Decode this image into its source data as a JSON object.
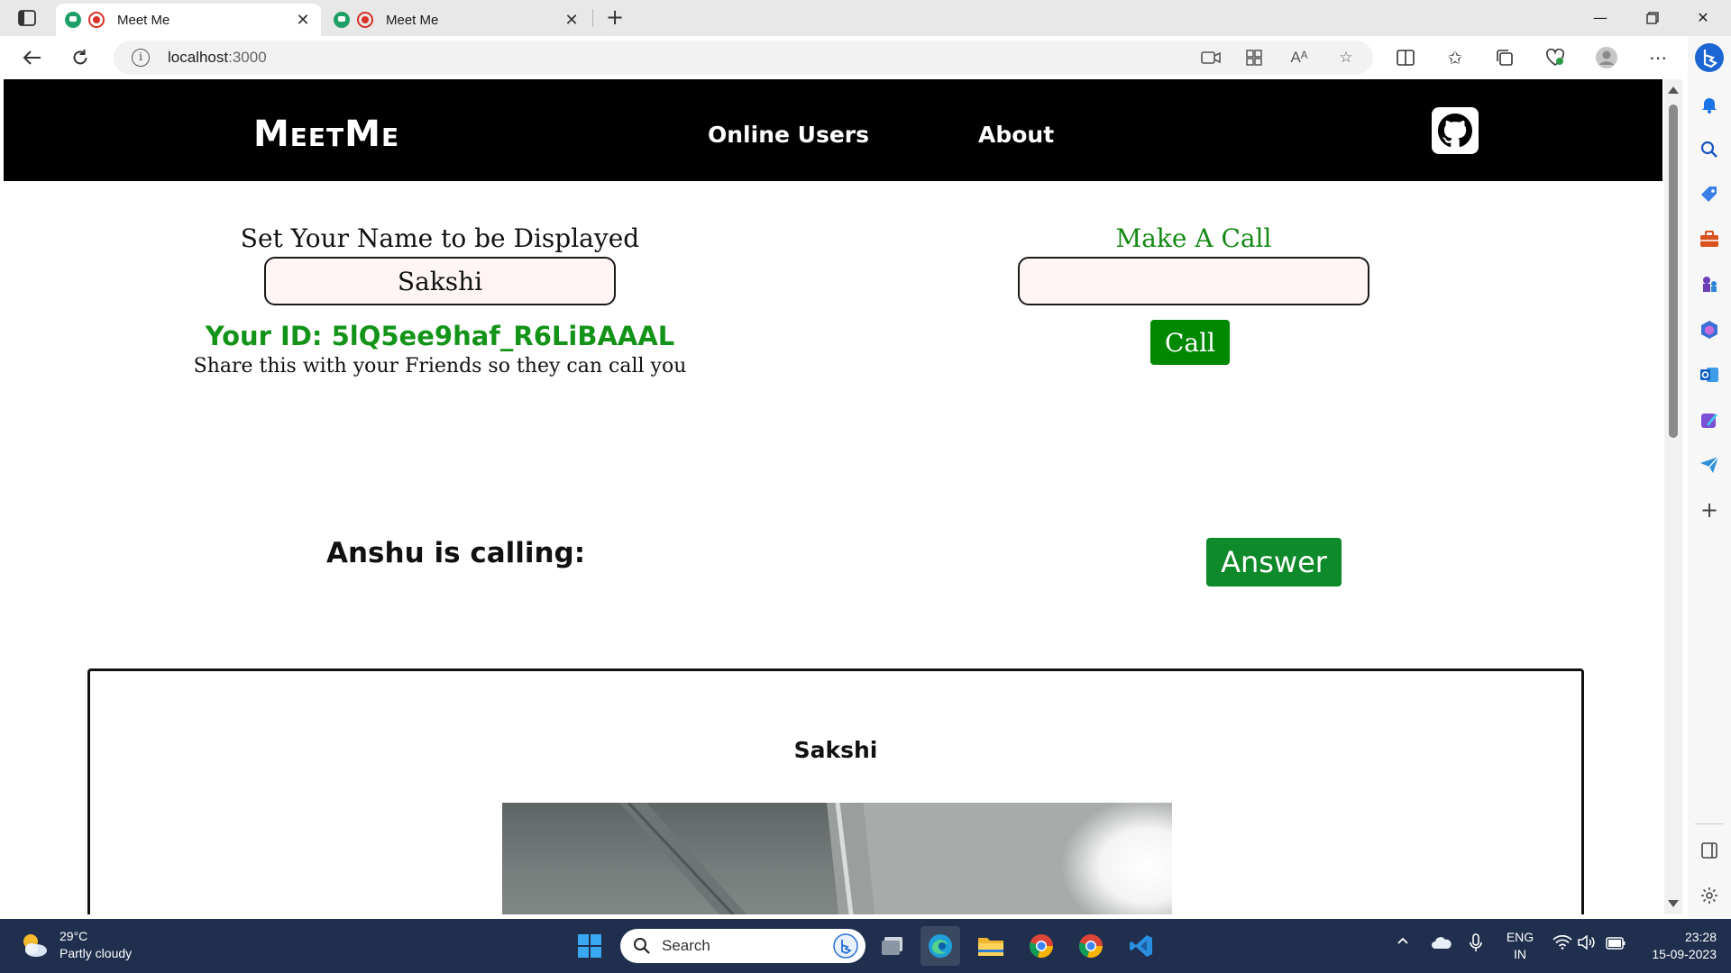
{
  "browser": {
    "tabs": [
      {
        "title": "Meet Me",
        "active": true
      },
      {
        "title": "Meet Me",
        "active": false
      }
    ],
    "address": {
      "host": "localhost",
      "port": ":3000"
    }
  },
  "app": {
    "brand": "MeetMe",
    "nav": {
      "online_users": "Online Users",
      "about": "About"
    },
    "set_name": {
      "label": "Set Your Name to be Displayed",
      "value": "Sakshi"
    },
    "your_id": "Your ID: 5lQ5ee9haf_R6LiBAAAL",
    "share_note": "Share this with your Friends so they can call you",
    "make_call": {
      "label": "Make A Call",
      "value": "",
      "button": "Call"
    },
    "incoming": {
      "text": "Anshu is calling:",
      "button": "Answer"
    },
    "video": {
      "name": "Sakshi"
    }
  },
  "taskbar": {
    "weather": {
      "temp": "29°C",
      "condition": "Partly cloudy"
    },
    "search_label": "Search",
    "lang": {
      "line1": "ENG",
      "line2": "IN"
    },
    "clock": {
      "time": "23:28",
      "date": "15-09-2023"
    }
  },
  "colors": {
    "navbar_bg": "#000000",
    "id_green": "#139418",
    "call_green": "#008800",
    "answer_green": "#0f8a2a",
    "input_bg": "#fff5f5",
    "taskbar_bg": "#1f2f4d"
  }
}
